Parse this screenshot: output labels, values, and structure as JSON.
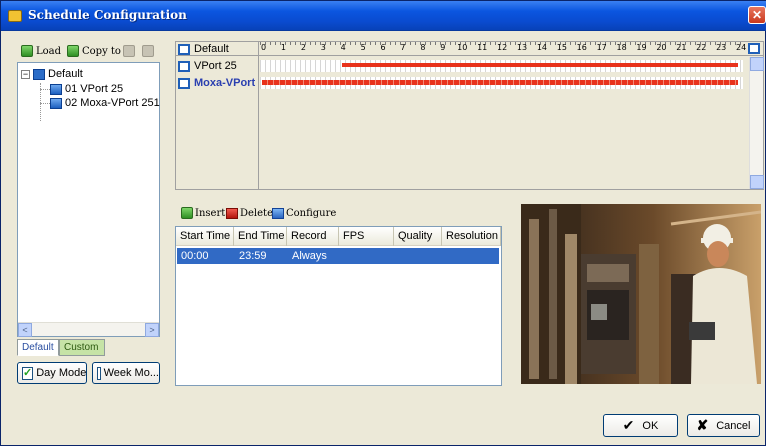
{
  "window": {
    "title": "Schedule Configuration",
    "close_glyph": "✕"
  },
  "left_toolbar": {
    "load_label": "Load",
    "copy_to_label": "Copy to"
  },
  "tree": {
    "root": {
      "expander": "−",
      "label": "Default",
      "icon": "schedule-icon"
    },
    "children": [
      {
        "label": "01 VPort 25",
        "icon": "camera-icon"
      },
      {
        "label": "02 Moxa-VPort 251",
        "icon": "camera-icon"
      }
    ],
    "scroll_left": "<",
    "scroll_right": ">"
  },
  "tabs": [
    {
      "label": "Default",
      "selected": true
    },
    {
      "label": "Custom",
      "selected": false
    }
  ],
  "modes": [
    {
      "label": "Day Mode",
      "checked": true,
      "check_glyph": "✓"
    },
    {
      "label": "Week Mo...",
      "checked": false,
      "check_glyph": ""
    }
  ],
  "schedule_grid": {
    "header_label": "Default",
    "hour_ticks": [
      "0",
      "1",
      "2",
      "3",
      "4",
      "5",
      "6",
      "7",
      "8",
      "9",
      "10",
      "11",
      "12",
      "13",
      "14",
      "15",
      "16",
      "17",
      "18",
      "19",
      "20",
      "21",
      "22",
      "23",
      "24"
    ],
    "rows": [
      {
        "label": "VPort 25",
        "bold": false,
        "start_hour": 4.0,
        "end_hour": 24.0
      },
      {
        "label": "Moxa-VPort",
        "bold": true,
        "start_hour": 0.0,
        "end_hour": 24.0
      }
    ],
    "bar_color": "#e8321c"
  },
  "time_toolbar": {
    "insert_label": "Insert",
    "delete_label": "Delete",
    "configure_label": "Configure"
  },
  "time_table": {
    "columns": [
      "Start Time",
      "End Time",
      "Record",
      "FPS",
      "Quality",
      "Resolution"
    ],
    "rows": [
      {
        "start": "00:00",
        "end": "23:59",
        "record": "Always",
        "fps": "",
        "quality": "",
        "resolution": ""
      }
    ],
    "selected_color": "#316ac5"
  },
  "buttons": {
    "ok_label": "OK",
    "ok_glyph": "✔",
    "cancel_label": "Cancel",
    "cancel_glyph": "✘"
  },
  "colors": {
    "title_bar": "#0b56e0",
    "window_bg": "#ece9d8",
    "custom_tab": "#c6e3a6"
  }
}
